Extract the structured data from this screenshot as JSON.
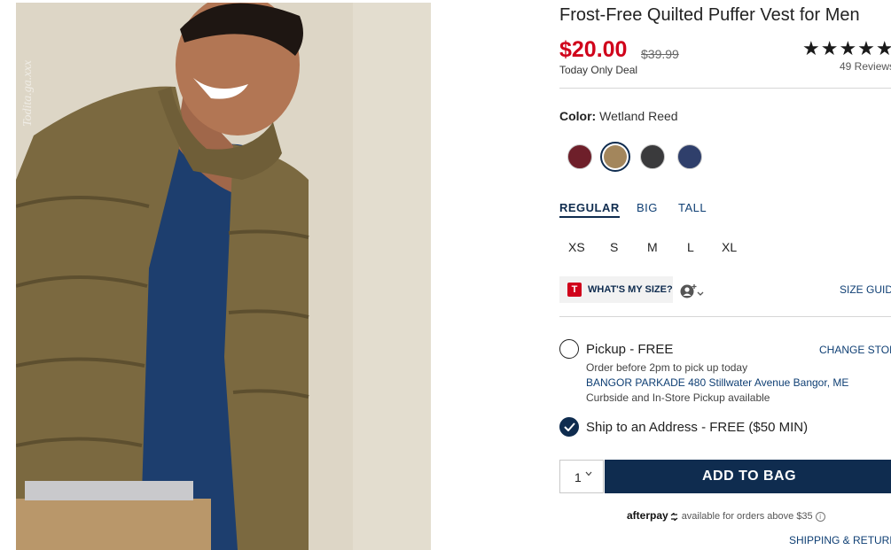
{
  "product": {
    "title": "Frost-Free Quilted Puffer Vest for Men",
    "price": "$20.00",
    "original_price": "$39.99",
    "deal_text": "Today Only Deal",
    "rating_stars": "★★★★★",
    "reviews_text": "49 Reviews",
    "watermark": "Todita.ga.xxx"
  },
  "color": {
    "label": "Color:",
    "value": "Wetland Reed",
    "swatches": [
      {
        "name": "dark-red",
        "hex": "#6e1f2a"
      },
      {
        "name": "wetland-reed",
        "hex": "#a3865c",
        "selected": true
      },
      {
        "name": "charcoal",
        "hex": "#3a3a3c"
      },
      {
        "name": "navy",
        "hex": "#2f3f6b"
      }
    ]
  },
  "fit_tabs": [
    "REGULAR",
    "BIG",
    "TALL"
  ],
  "sizes": [
    "XS",
    "S",
    "M",
    "L",
    "XL"
  ],
  "size_tools": {
    "badge": "T",
    "whats_my_size": "WHAT'S MY SIZE?",
    "size_guide": "SIZE GUIDE"
  },
  "pickup": {
    "label": "Pickup - FREE",
    "change_store": "CHANGE STORE",
    "note1": "Order before 2pm to pick up today",
    "store": "BANGOR PARKADE 480 Stillwater Avenue  Bangor, ME",
    "note2": "Curbside and In-Store Pickup available"
  },
  "ship": {
    "label": "Ship to an Address - FREE ($50 MIN)"
  },
  "cart": {
    "quantity": "1",
    "add_button": "ADD TO BAG"
  },
  "afterpay": {
    "logo": "afterpay",
    "text": "available for orders above $35"
  },
  "shipping_returns": "SHIPPING & RETURNS",
  "colors": {
    "accent": "#0f2c4f",
    "price_red": "#d0021b",
    "link_blue": "#0f3f74"
  }
}
